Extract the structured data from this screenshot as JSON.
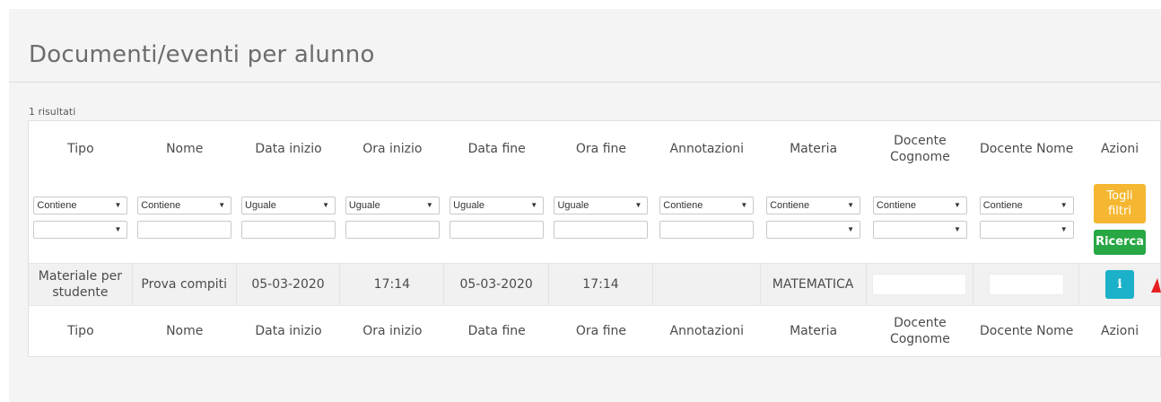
{
  "page": {
    "title": "Documenti/eventi per alunno",
    "results": "1 risultati"
  },
  "columns": [
    "Tipo",
    "Nome",
    "Data inizio",
    "Ora inizio",
    "Data fine",
    "Ora fine",
    "Annotazioni",
    "Materia",
    "Docente Cognome",
    "Docente Nome",
    "Azioni"
  ],
  "filters": {
    "tipo": "Contiene",
    "nome": "Contiene",
    "data_inizio": "Uguale",
    "ora_inizio": "Uguale",
    "data_fine": "Uguale",
    "ora_fine": "Uguale",
    "annotazioni": "Contiene",
    "materia": "Contiene",
    "docente_cognome": "Contiene",
    "docente_nome": "Contiene"
  },
  "actions": {
    "togli_filtri": "Togli filtri",
    "ricerca": "Ricerca",
    "info_glyph": "i"
  },
  "rows": [
    {
      "tipo": "Materiale per studente",
      "nome": "Prova compiti",
      "data_inizio": "05-03-2020",
      "ora_inizio": "17:14",
      "data_fine": "05-03-2020",
      "ora_fine": "17:14",
      "annotazioni": "",
      "materia": "MATEMATICA",
      "docente_cognome": "",
      "docente_nome": ""
    }
  ],
  "colors": {
    "togli": "#f5b731",
    "ricerca": "#28a745",
    "info": "#1bb1c9",
    "marker": "#e62020"
  }
}
